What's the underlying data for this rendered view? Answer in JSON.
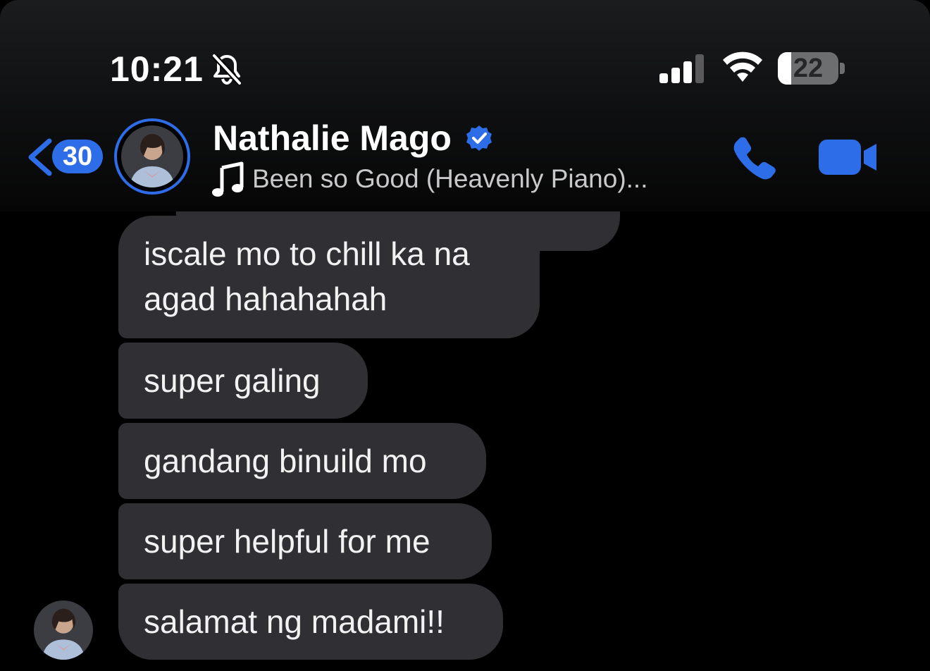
{
  "status_bar": {
    "time": "10:21",
    "battery_level": "22",
    "battery_fraction": 0.22
  },
  "header": {
    "unread_count": "30",
    "contact_name": "Nathalie Mago",
    "now_playing": "Been so Good (Heavenly Piano)..."
  },
  "messages": [
    {
      "lines": [
        "iscale mo to chill ka na",
        "agad hahahahah"
      ]
    },
    {
      "text": "super galing"
    },
    {
      "text": "gandang binuild mo"
    },
    {
      "text": "super helpful for me"
    },
    {
      "text": "salamat ng madami!!"
    }
  ],
  "icons": {
    "silent": "bell-slash-icon",
    "signal": "cellular-signal-icon",
    "wifi": "wifi-icon",
    "back": "chevron-left-icon",
    "verified": "verified-badge-icon",
    "music": "music-note-icon",
    "call": "phone-icon",
    "video": "video-camera-icon"
  },
  "colors": {
    "accent": "#2e6de8",
    "bubble": "#303034",
    "background": "#000000"
  }
}
